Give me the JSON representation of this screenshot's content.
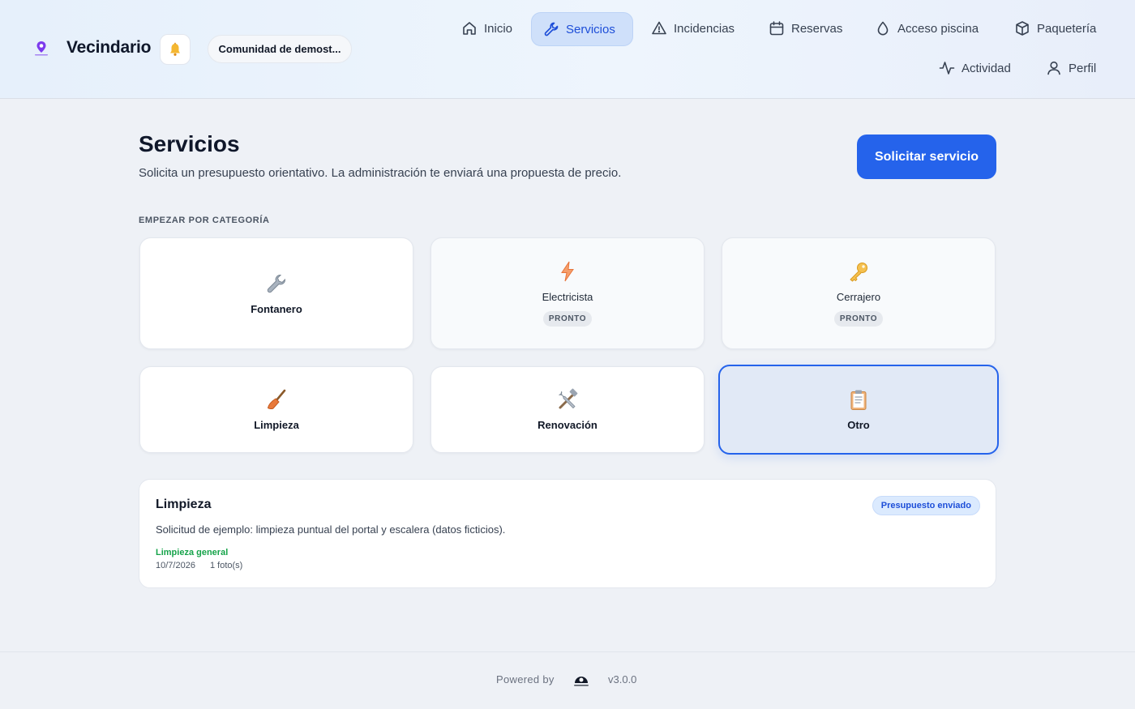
{
  "app": {
    "name": "Vecindario",
    "community": "Comunidad de demost..."
  },
  "nav": {
    "inicio": "Inicio",
    "servicios": "Servicios",
    "incidencias": "Incidencias",
    "reservas": "Reservas",
    "acceso_piscina": "Acceso piscina",
    "paqueteria": "Paquetería",
    "actividad": "Actividad",
    "perfil": "Perfil",
    "active": "Servicios"
  },
  "page": {
    "title": "Servicios",
    "subtitle": "Solicita un presupuesto orientativo. La administración te enviará una propuesta de precio.",
    "primary_action": "Solicitar servicio",
    "section_label": "EMPEZAR POR CATEGORÍA"
  },
  "categories": [
    {
      "label": "Fontanero",
      "icon": "wrench-icon",
      "badge": ""
    },
    {
      "label": "Electricista",
      "icon": "lightning-icon",
      "badge": "PRONTO"
    },
    {
      "label": "Cerrajero",
      "icon": "key-icon",
      "badge": "PRONTO"
    },
    {
      "label": "Limpieza",
      "icon": "broom-icon",
      "badge": ""
    },
    {
      "label": "Renovación",
      "icon": "tools-icon",
      "badge": ""
    },
    {
      "label": "Otro",
      "icon": "clipboard-icon",
      "badge": "",
      "selected": true
    }
  ],
  "requests": [
    {
      "title": "Limpieza",
      "status": "Presupuesto enviado",
      "description": "Solicitud de ejemplo: limpieza puntual del portal y escalera (datos ficticios).",
      "type": "Limpieza general",
      "date": "10/7/2026",
      "photos": "1 foto(s)"
    }
  ],
  "footer": {
    "powered_by": "Powered by",
    "version": "v3.0.0"
  },
  "colors": {
    "primary": "#2563eb",
    "accent_bg": "#cfe0fa",
    "success": "#16a34a"
  }
}
